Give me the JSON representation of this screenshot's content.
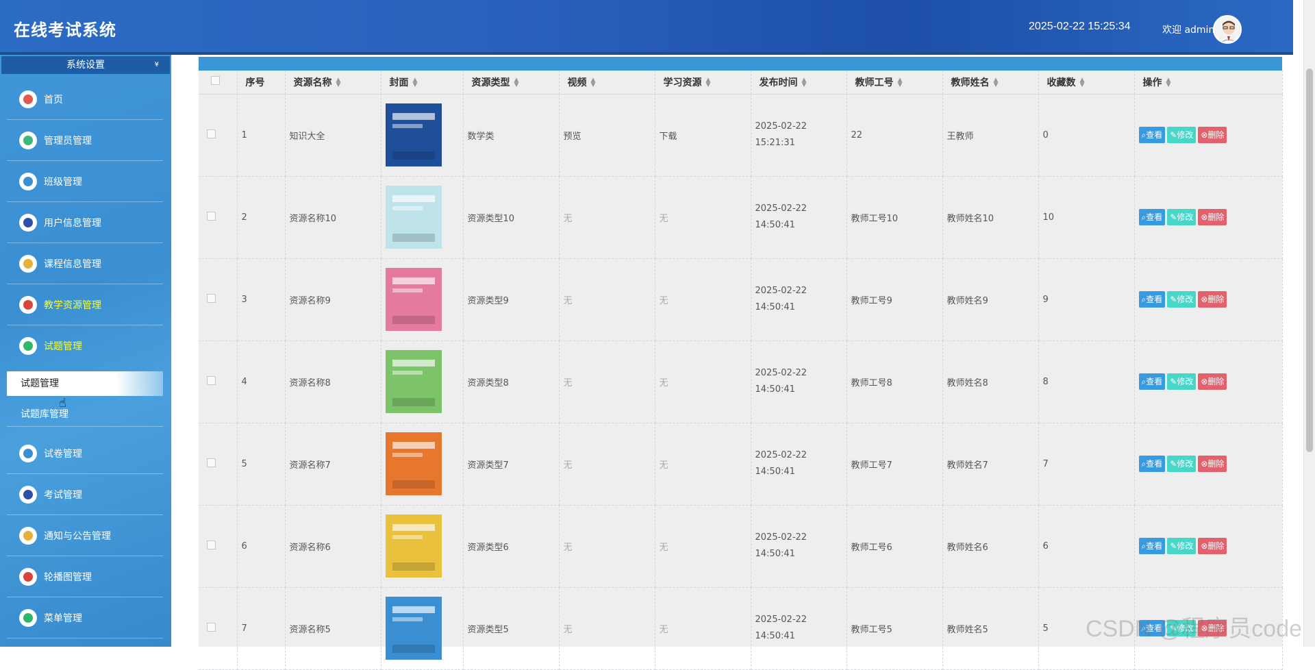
{
  "app": {
    "title": "在线考试系统",
    "datetime": "2025-02-22 15:25:34",
    "welcome": "欢迎 admin"
  },
  "sidebar": {
    "settings_label": "系统设置",
    "items": [
      {
        "label": "首页",
        "icon": "home-icon",
        "color": "#e05a4f"
      },
      {
        "label": "管理员管理",
        "icon": "admin-icon",
        "color": "#3cb878"
      },
      {
        "label": "班级管理",
        "icon": "class-icon",
        "color": "#3a8fd2"
      },
      {
        "label": "用户信息管理",
        "icon": "user-icon",
        "color": "#2d4fa8"
      },
      {
        "label": "课程信息管理",
        "icon": "course-icon",
        "color": "#e8b03a"
      },
      {
        "label": "教学资源管理",
        "icon": "resource-icon",
        "color": "#d9453b"
      },
      {
        "label": "试题管理",
        "icon": "question-icon",
        "color": "#2fb86a"
      },
      {
        "label": "试卷管理",
        "icon": "paper-icon",
        "color": "#3a8fd2"
      },
      {
        "label": "考试管理",
        "icon": "exam-icon",
        "color": "#2d4fa8"
      },
      {
        "label": "通知与公告管理",
        "icon": "notice-icon",
        "color": "#e8b03a"
      },
      {
        "label": "轮播图管理",
        "icon": "carousel-icon",
        "color": "#d9453b"
      },
      {
        "label": "菜单管理",
        "icon": "menu-icon",
        "color": "#2fb86a"
      }
    ],
    "sub_items": [
      "试题管理",
      "试题库管理"
    ]
  },
  "table": {
    "headers": [
      "序号",
      "资源名称",
      "封面",
      "资源类型",
      "视频",
      "学习资源",
      "发布时间",
      "教师工号",
      "教师姓名",
      "收藏数",
      "操作"
    ],
    "rows": [
      {
        "no": "1",
        "name": "知识大全",
        "type": "数学类",
        "video": "预览",
        "res": "下载",
        "time": "2025-02-22 15:21:31",
        "tid": "22",
        "tname": "王教师",
        "fav": "0",
        "cover": "#1f4f9a"
      },
      {
        "no": "2",
        "name": "资源名称10",
        "type": "资源类型10",
        "video": "无",
        "res": "无",
        "time": "2025-02-22 14:50:41",
        "tid": "教师工号10",
        "tname": "教师姓名10",
        "fav": "10",
        "cover": "#bfe3ea"
      },
      {
        "no": "3",
        "name": "资源名称9",
        "type": "资源类型9",
        "video": "无",
        "res": "无",
        "time": "2025-02-22 14:50:41",
        "tid": "教师工号9",
        "tname": "教师姓名9",
        "fav": "9",
        "cover": "#e47a9e"
      },
      {
        "no": "4",
        "name": "资源名称8",
        "type": "资源类型8",
        "video": "无",
        "res": "无",
        "time": "2025-02-22 14:50:41",
        "tid": "教师工号8",
        "tname": "教师姓名8",
        "fav": "8",
        "cover": "#7cc36a"
      },
      {
        "no": "5",
        "name": "资源名称7",
        "type": "资源类型7",
        "video": "无",
        "res": "无",
        "time": "2025-02-22 14:50:41",
        "tid": "教师工号7",
        "tname": "教师姓名7",
        "fav": "7",
        "cover": "#e8772e"
      },
      {
        "no": "6",
        "name": "资源名称6",
        "type": "资源类型6",
        "video": "无",
        "res": "无",
        "time": "2025-02-22 14:50:41",
        "tid": "教师工号6",
        "tname": "教师姓名6",
        "fav": "6",
        "cover": "#e9c13c"
      },
      {
        "no": "7",
        "name": "资源名称5",
        "type": "资源类型5",
        "video": "无",
        "res": "无",
        "time": "2025-02-22 14:50:41",
        "tid": "教师工号5",
        "tname": "教师姓名5",
        "fav": "5",
        "cover": "#3a8fd2"
      }
    ],
    "actions": {
      "view": "查看",
      "edit": "修改",
      "delete": "删除"
    }
  },
  "watermark": "CSDN @程序员code"
}
